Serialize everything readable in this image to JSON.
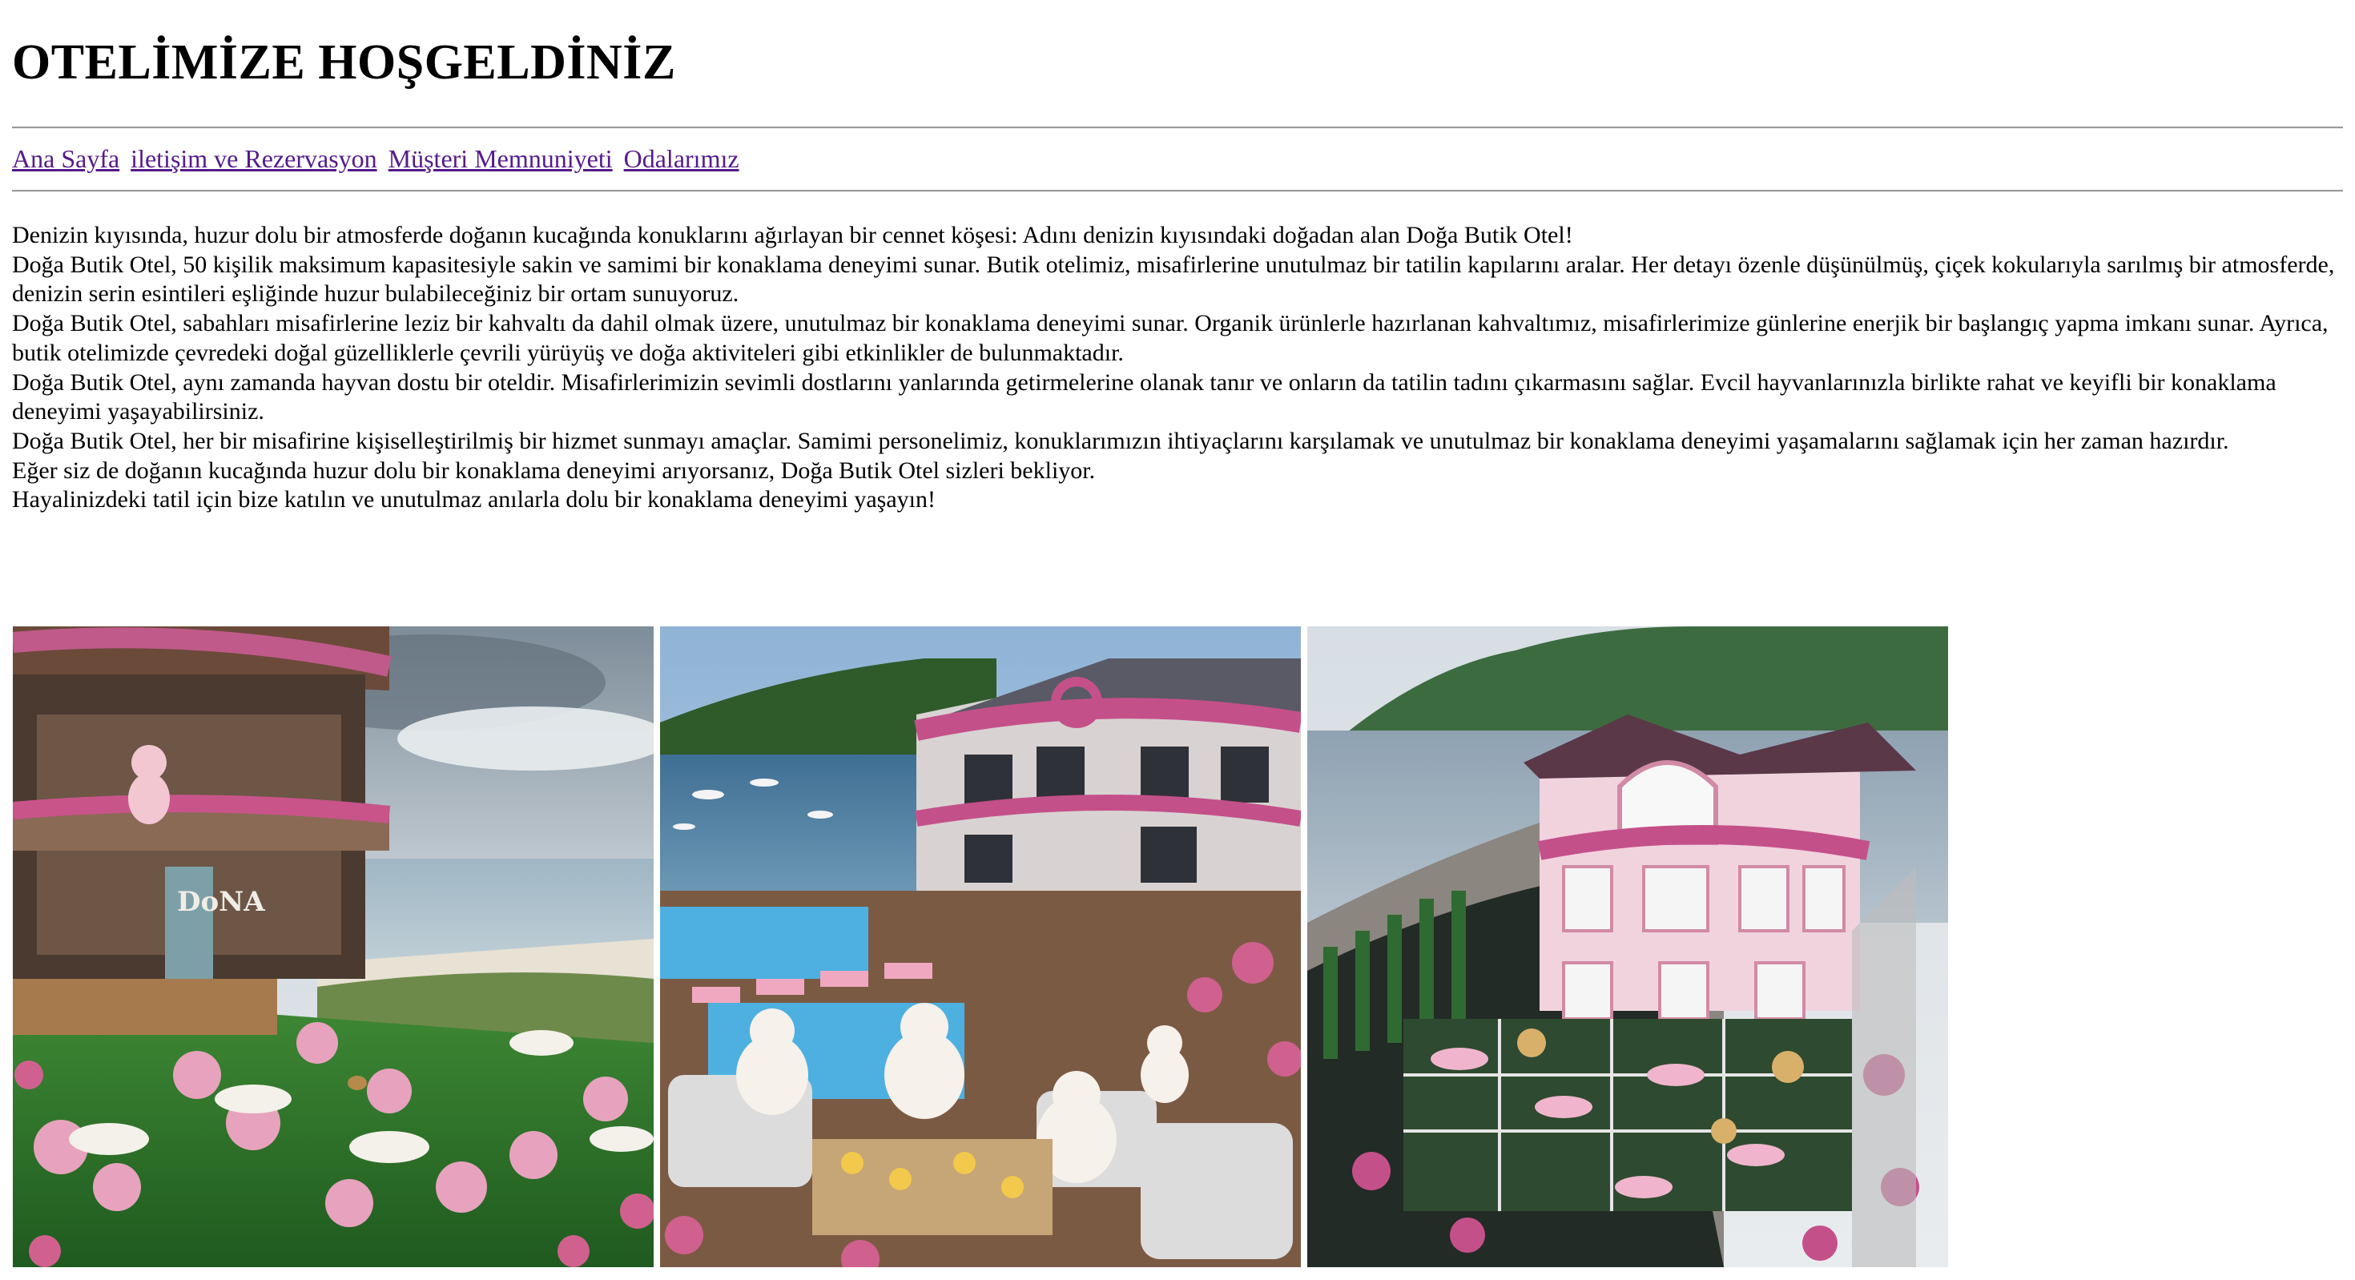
{
  "header": {
    "title": "OTELİMİZE HOŞGELDİNİZ"
  },
  "nav": {
    "items": [
      {
        "label": "Ana Sayfa"
      },
      {
        "label": "iletişim ve Rezervasyon"
      },
      {
        "label": "Müşteri Memnuniyeti"
      },
      {
        "label": "Odalarımız"
      }
    ]
  },
  "content": {
    "paragraphs": [
      "Denizin kıyısında, huzur dolu bir atmosferde doğanın kucağında konuklarını ağırlayan bir cennet köşesi: Adını denizin kıyısındaki doğadan alan Doğa Butik Otel!",
      "Doğa Butik Otel, 50 kişilik maksimum kapasitesiyle sakin ve samimi bir konaklama deneyimi sunar. Butik otelimiz, misafirlerine unutulmaz bir tatilin kapılarını aralar. Her detayı özenle düşünülmüş, çiçek kokularıyla sarılmış bir atmosferde, denizin serin esintileri eşliğinde huzur bulabileceğiniz bir ortam sunuyoruz.",
      "Doğa Butik Otel, sabahları misafirlerine leziz bir kahvaltı da dahil olmak üzere, unutulmaz bir konaklama deneyimi sunar. Organik ürünlerle hazırlanan kahvaltımız, misafirlerimize günlerine enerjik bir başlangıç yapma imkanı sunar. Ayrıca, butik otelimizde çevredeki doğal güzelliklerle çevrili yürüyüş ve doğa aktiviteleri gibi etkinlikler de bulunmaktadır.",
      "Doğa Butik Otel, aynı zamanda hayvan dostu bir oteldir. Misafirlerimizin sevimli dostlarını yanlarında getirmelerine olanak tanır ve onların da tatilin tadını çıkarmasını sağlar. Evcil hayvanlarınızla birlikte rahat ve keyifli bir konaklama deneyimi yaşayabilirsiniz.",
      "Doğa Butik Otel, her bir misafirine kişiselleştirilmiş bir hizmet sunmayı amaçlar. Samimi personelimiz, konuklarımızın ihtiyaçlarını karşılamak ve unutulmaz bir konaklama deneyimi yaşamalarını sağlamak için her zaman hazırdır.",
      "Eğer siz de doğanın kucağında huzur dolu bir konaklama deneyimi arıyorsanız, Doğa Butik Otel sizleri bekliyor.",
      "Hayalinizdeki tatil için bize katılın ve unutulmaz anılarla dolu bir konaklama deneyimi yaşayın!"
    ]
  },
  "gallery": {
    "images": [
      {
        "sign": "DoNA"
      },
      {
        "sign": ""
      },
      {
        "sign": ""
      }
    ]
  },
  "colors": {
    "link": "#551a8b",
    "rule": "#9a9a9a"
  }
}
